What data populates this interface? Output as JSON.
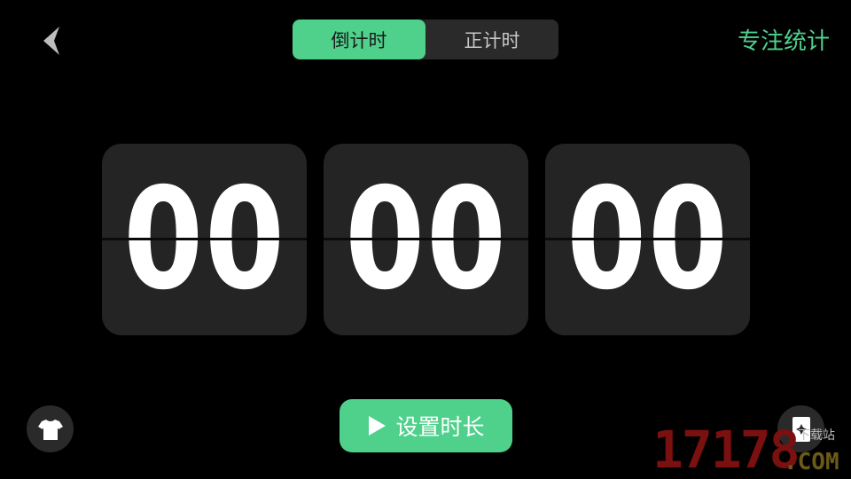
{
  "header": {
    "tabs": [
      {
        "label": "倒计时",
        "active": true
      },
      {
        "label": "正计时",
        "active": false
      }
    ],
    "stats_label": "专注统计"
  },
  "timer": {
    "hours": "00",
    "minutes": "00",
    "seconds": "00"
  },
  "controls": {
    "set_duration_label": "设置时长"
  },
  "watermark": {
    "number": "17178",
    "domain": ".COM",
    "caption": "下载站"
  },
  "colors": {
    "accent": "#4fd08b",
    "background": "#000000",
    "card": "#242424"
  },
  "icons": {
    "back": "chevron-left-icon",
    "skin": "tshirt-icon",
    "card": "card-icon",
    "play": "play-icon"
  }
}
